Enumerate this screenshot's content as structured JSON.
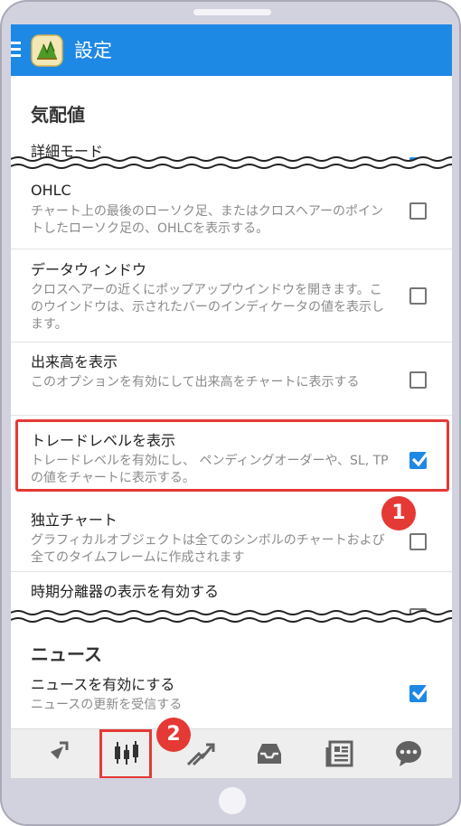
{
  "app": {
    "title": "設定"
  },
  "sections": [
    {
      "header": "気配値"
    },
    {
      "header": "ニュース"
    }
  ],
  "items": [
    {
      "title": "詳細モード",
      "desc": "",
      "checked": true
    },
    {
      "title": "OHLC",
      "desc": "チャート上の最後のローソク足、またはクロスヘアーのポイントしたローソク足の、OHLCを表示する。",
      "checked": false
    },
    {
      "title": "データウィンドウ",
      "desc": "クロスヘアーの近くにポップアップウインドウを開きます。このウインドウは、示されたバーのインディケータの値を表示します。",
      "checked": false
    },
    {
      "title": "出来高を表示",
      "desc": "このオプションを有効にして出来高をチャートに表示する",
      "checked": false
    },
    {
      "title": "トレードレベルを表示",
      "desc": "トレードレベルを有効にし、 ペンディングオーダーや、SL, TP の値をチャートに表示する。",
      "checked": true
    },
    {
      "title": "独立チャート",
      "desc": "グラフィカルオブジェクトは全てのシンボルのチャートおよび全てのタイムフレームに作成されます",
      "checked": false
    },
    {
      "title": "時期分離器の表示を有効する",
      "desc": "",
      "checked": false
    },
    {
      "title": "ニュースを有効にする",
      "desc": "ニュースの更新を受信する",
      "checked": true
    }
  ],
  "badges": {
    "one": "1",
    "two": "2"
  },
  "nav": [
    {
      "icon": "quotes-icon"
    },
    {
      "icon": "chart-candles-icon"
    },
    {
      "icon": "trade-icon"
    },
    {
      "icon": "history-inbox-icon"
    },
    {
      "icon": "news-icon"
    },
    {
      "icon": "chat-icon"
    }
  ],
  "colors": {
    "accent": "#1e88e5",
    "check": "#1e88e5",
    "highlight": "#e53935"
  }
}
